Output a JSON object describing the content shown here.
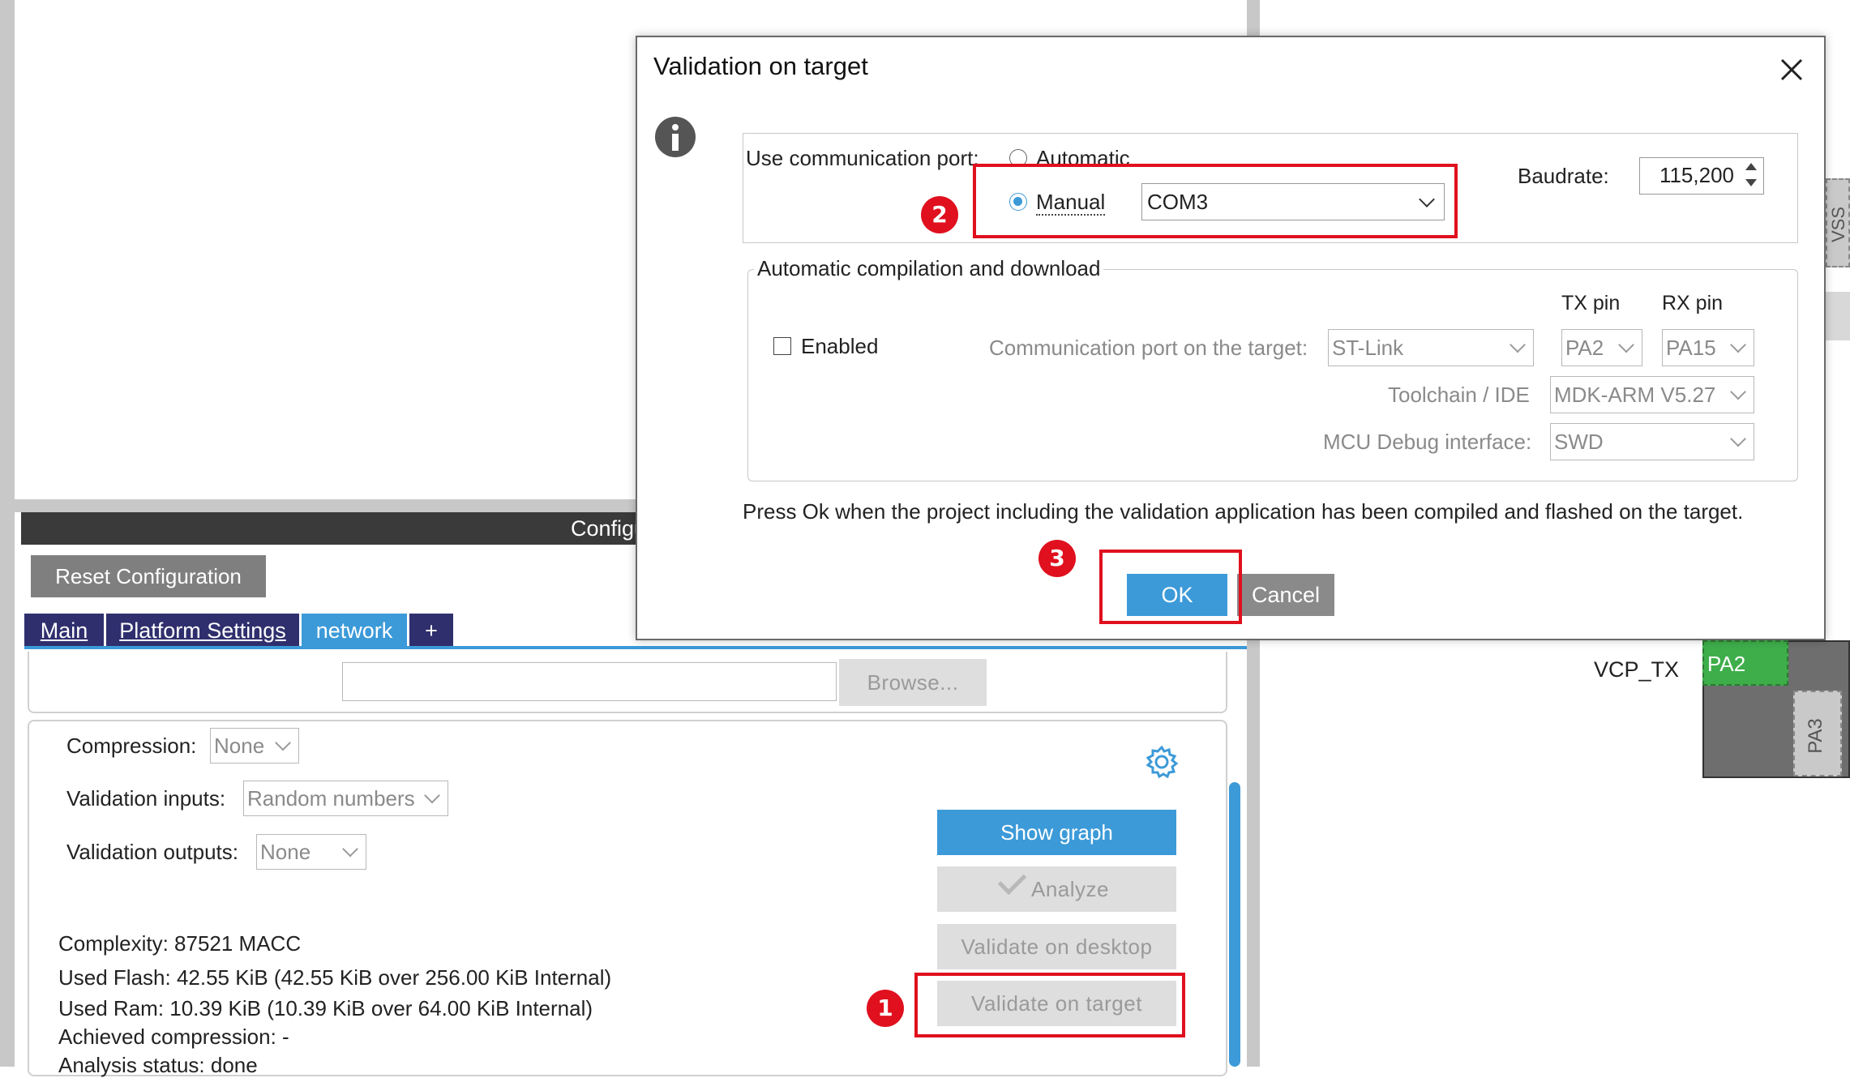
{
  "background": {
    "section_title": "Configu",
    "reset_button": "Reset Configuration",
    "tabs": [
      "Main",
      "Platform Settings",
      "network",
      "+"
    ],
    "browse_button": "Browse...",
    "compression_label": "Compression:",
    "compression_value": "None",
    "validation_inputs_label": "Validation inputs:",
    "validation_inputs_value": "Random numbers",
    "validation_outputs_label": "Validation outputs:",
    "validation_outputs_value": "None",
    "show_graph": "Show graph",
    "analyze": "Analyze",
    "validate_desktop": "Validate on desktop",
    "validate_target": "Validate on target",
    "complexity": "Complexity:  87521 MACC",
    "used_flash": "Used Flash: 42.55 KiB (42.55 KiB over 256.00 KiB Internal)",
    "used_ram": "Used Ram: 10.39 KiB (10.39 KiB over 64.00 KiB Internal)",
    "achieved_compression": "Achieved compression: -",
    "analysis_status": "Analysis status: done",
    "pin_label": "VCP_TX",
    "pin_pa2": "PA2",
    "pin_pa3": "PA3",
    "pin_vss": "VSS"
  },
  "dialog": {
    "title": "Validation on target",
    "comm_port_label": "Use communication port:",
    "automatic_label": "Automatic",
    "manual_label": "Manual",
    "com_value": "COM3",
    "baudrate_label": "Baudrate:",
    "baudrate_value": "115,200",
    "group_title": "Automatic compilation and download",
    "tx_pin_label": "TX pin",
    "rx_pin_label": "RX pin",
    "enabled_label": "Enabled",
    "comm_target_label": "Communication port on the target:",
    "comm_target_value": "ST-Link",
    "tx_pin_value": "PA2",
    "rx_pin_value": "PA15",
    "toolchain_label": "Toolchain / IDE",
    "toolchain_value": "MDK-ARM V5.27",
    "debug_label": "MCU Debug interface:",
    "debug_value": "SWD",
    "message": "Press Ok when the project including the validation application has been compiled and flashed on the target.",
    "ok_button": "OK",
    "cancel_button": "Cancel"
  },
  "annotations": [
    "1",
    "2",
    "3"
  ],
  "colors": {
    "accent": "#3c9ad8",
    "annotation": "#e0101e",
    "header_dark": "#3a3a3a",
    "tab_active": "#2f2f6e",
    "pin_green": "#3eae4a"
  },
  "icons": [
    "info-icon",
    "close-icon",
    "gear-icon",
    "check-icon",
    "chevron-down-icon"
  ]
}
